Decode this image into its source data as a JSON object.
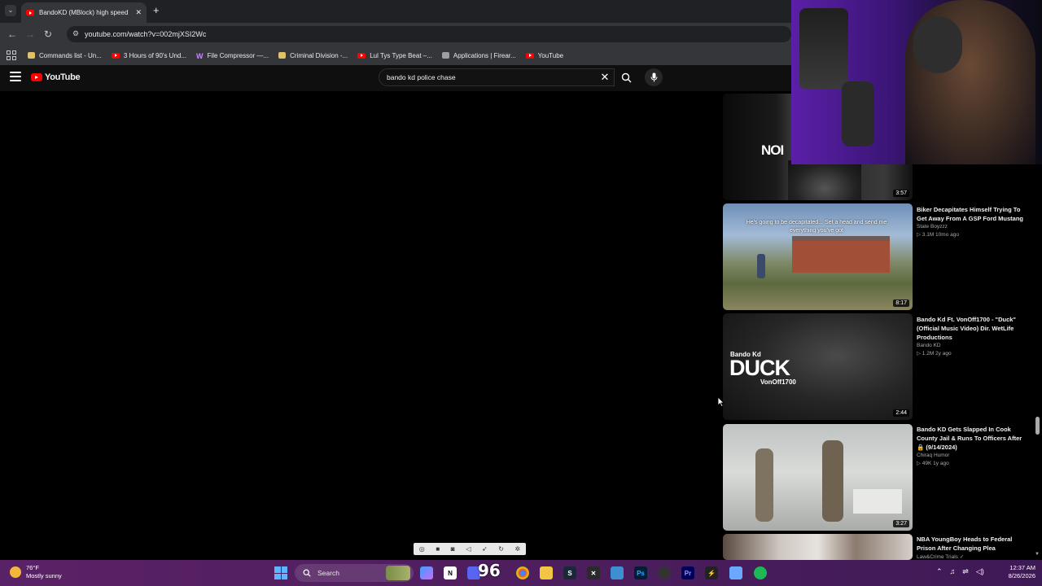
{
  "browser": {
    "tab_title": "BandoKD (MBlock) high speed",
    "new_tab": "+",
    "url": "youtube.com/watch?v=002mjXSI2Wc",
    "bookmarks": [
      {
        "label": "Commands list - Un...",
        "icon": "folder"
      },
      {
        "label": "3 Hours of 90's Und...",
        "icon": "youtube"
      },
      {
        "label": "File Compressor —...",
        "icon": "w"
      },
      {
        "label": "Criminal Division -...",
        "icon": "folder"
      },
      {
        "label": "Lul Tys Type Beat –...",
        "icon": "youtube"
      },
      {
        "label": "Applications | Firear...",
        "icon": "grey"
      },
      {
        "label": "YouTube",
        "icon": "youtube"
      }
    ]
  },
  "youtube": {
    "logo_text": "YouTube",
    "search_value": "bando kd police chase",
    "videos": [
      {
        "title": "",
        "channel": "",
        "stats": "",
        "duration": "3:57",
        "thumb_text": "NOI"
      },
      {
        "title": "Biker Decapitates Himself Trying To Get Away From A GSP Ford Mustang",
        "channel": "State Boyzzz",
        "stats": "▷ 3.1M  10mo ago",
        "duration": "8:17",
        "thumb_text": "He's going to be decapitated... Set a head and send me everything you've got"
      },
      {
        "title": "Bando Kd Ft. VonOff1700 - \"Duck\" (Official Music Video) Dir. WetLife Productions",
        "channel": "Bando KD",
        "stats": "▷ 1.2M  2y ago",
        "duration": "2:44",
        "thumb_text": "DUCK",
        "thumb_sub": "Bando Kd",
        "thumb_sub2": "VonOff1700"
      },
      {
        "title": "Bando KD Gets Slapped In Cook County Jail & Runs To Officers After 🔒 (9/14/2024)",
        "channel": "Chiraq Humor",
        "stats": "▷ 49K  1y ago",
        "duration": "3:27",
        "thumb_text": ""
      },
      {
        "title": "NBA YoungBoy Heads to Federal Prison After Changing Plea",
        "channel": "Law&Crime Trials ✓",
        "stats": "",
        "duration": "",
        "thumb_text": ""
      }
    ]
  },
  "overlay_counter": "96",
  "taskbar": {
    "temperature": "76°F",
    "condition": "Mostly sunny",
    "search_label": "Search",
    "time": "12:37 AM",
    "date": "8/26/2026"
  },
  "colors": {
    "youtube_red": "#ff0000",
    "taskbar": "#5a2266",
    "chrome_dark": "#202124"
  }
}
